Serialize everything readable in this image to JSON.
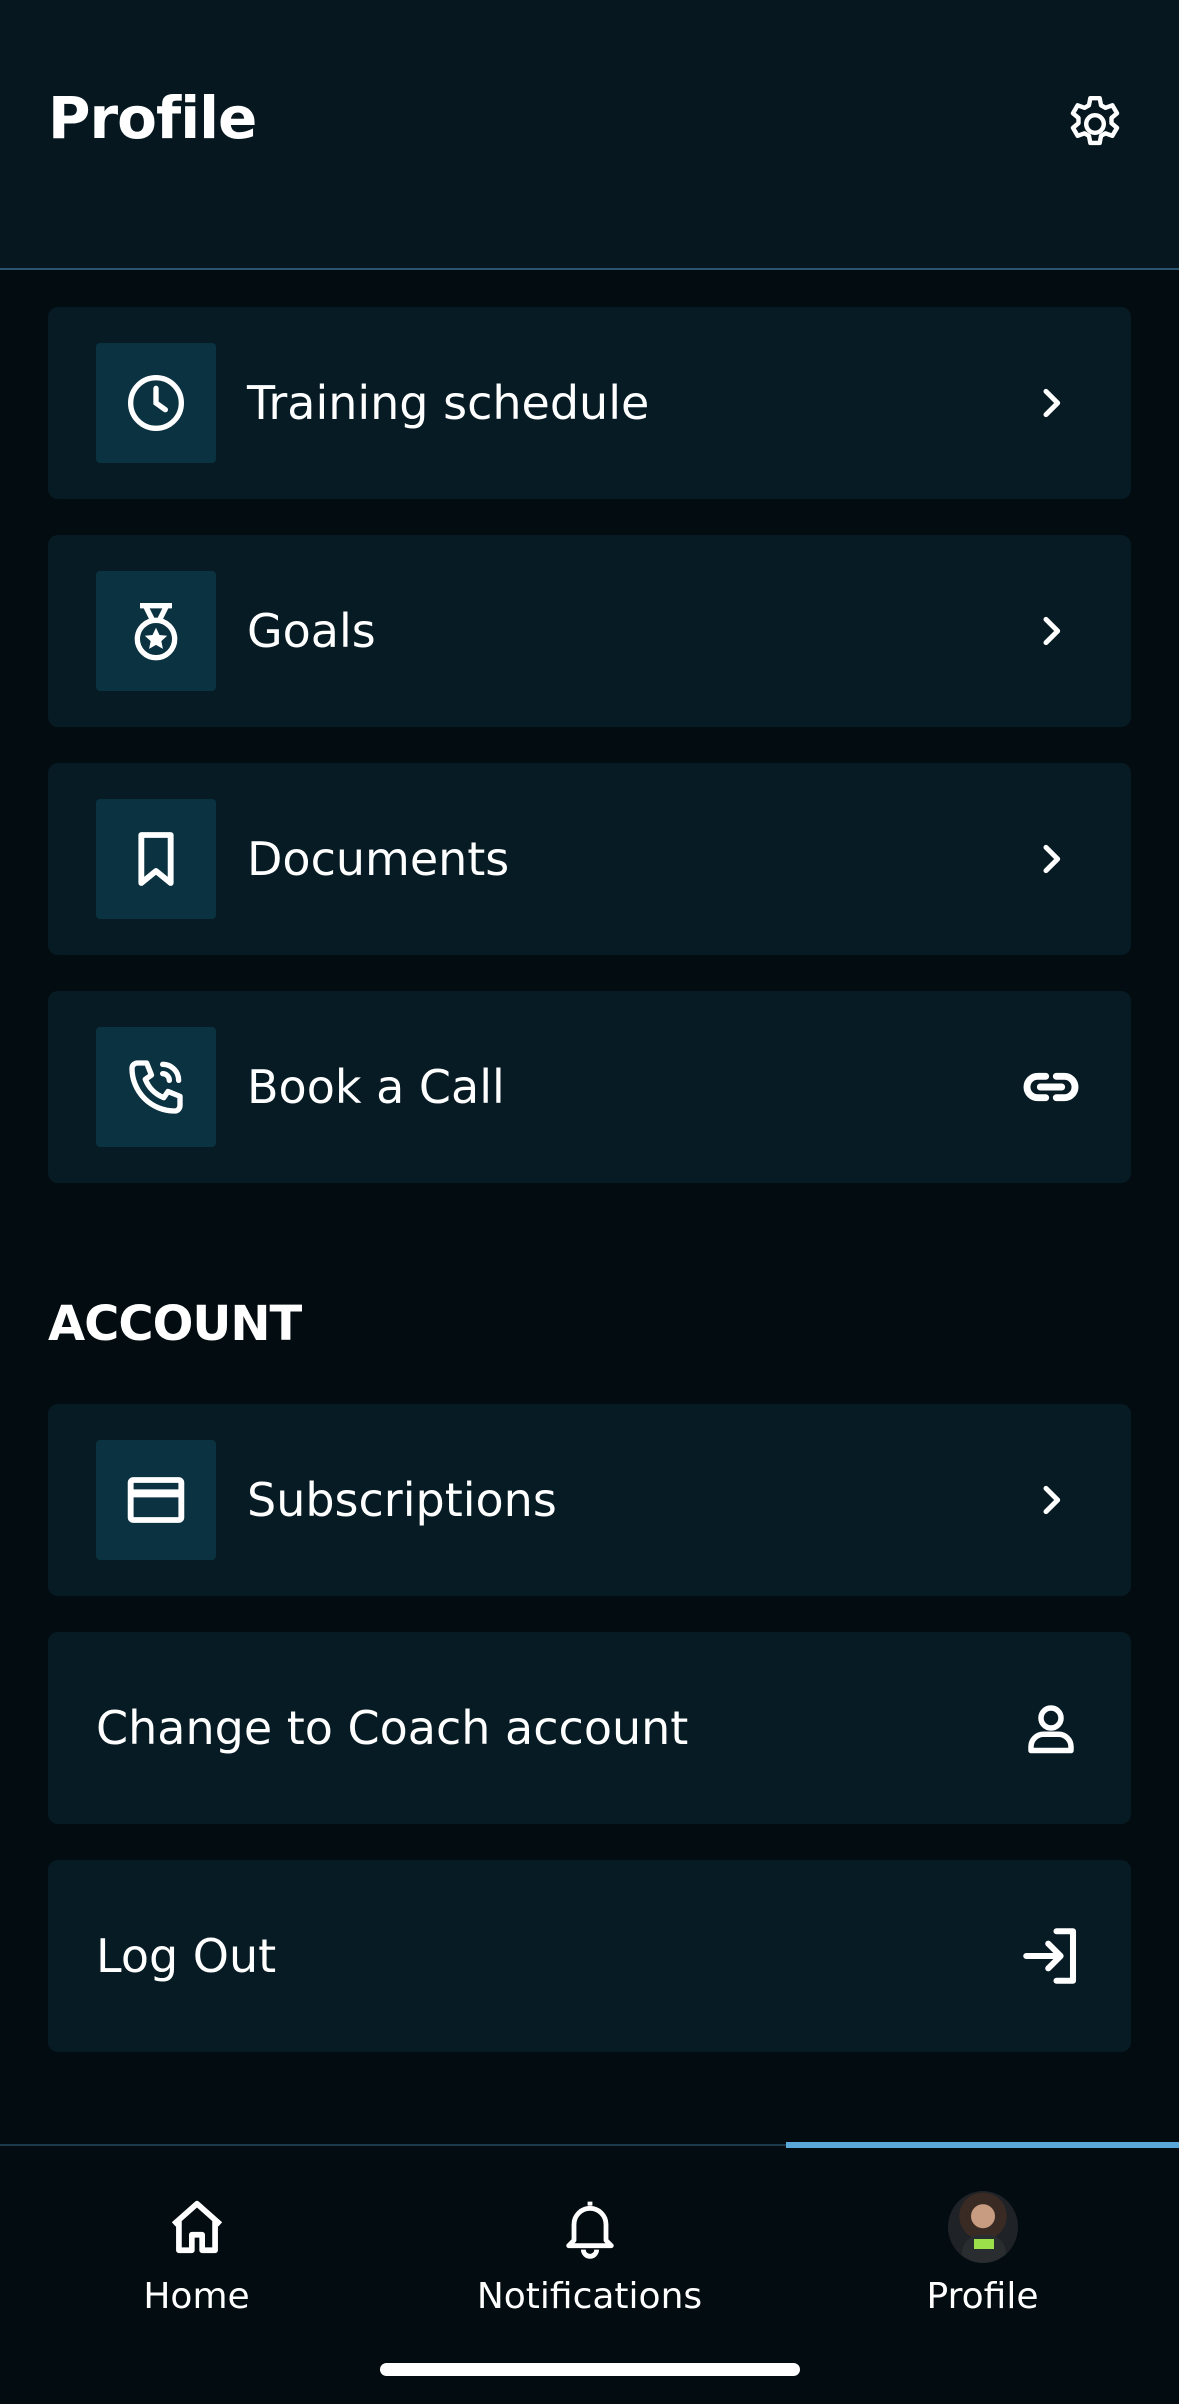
{
  "header": {
    "title": "Profile"
  },
  "menu": [
    {
      "label": "Training schedule",
      "icon": "clock-icon",
      "trail": "chevron-right-icon"
    },
    {
      "label": "Goals",
      "icon": "medal-icon",
      "trail": "chevron-right-icon"
    },
    {
      "label": "Documents",
      "icon": "bookmark-icon",
      "trail": "chevron-right-icon"
    },
    {
      "label": "Book a Call",
      "icon": "phone-call-icon",
      "trail": "link-icon"
    }
  ],
  "account": {
    "title": "ACCOUNT",
    "items": [
      {
        "label": "Subscriptions",
        "icon": "credit-card-icon",
        "trail": "chevron-right-icon"
      },
      {
        "label": "Change to Coach account",
        "trail": "user-icon"
      },
      {
        "label": "Log Out",
        "trail": "log-in-icon"
      }
    ]
  },
  "nav": [
    {
      "label": "Home",
      "icon": "home-icon"
    },
    {
      "label": "Notifications",
      "icon": "bell-icon"
    },
    {
      "label": "Profile",
      "icon": "avatar",
      "active": true
    }
  ],
  "colors": {
    "background": "#030c10",
    "card": "#061b24",
    "icon_box": "#0a3240",
    "accent": "#5aa8d8"
  }
}
